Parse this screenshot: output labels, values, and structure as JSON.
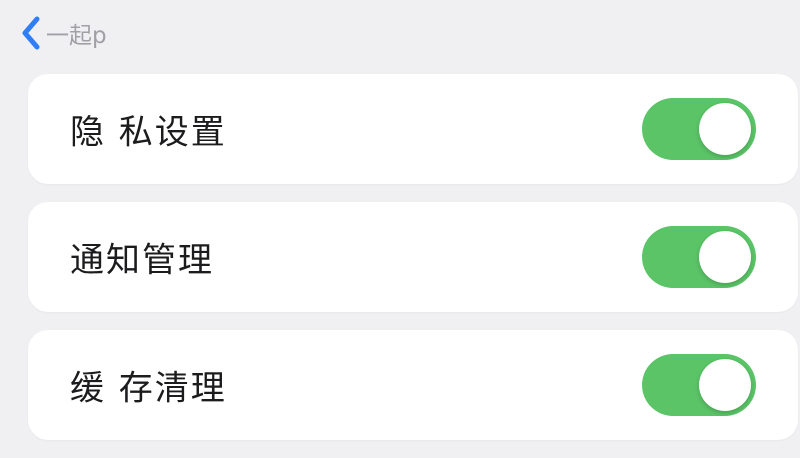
{
  "nav": {
    "back_icon": "chevron-left-icon",
    "back_label": "一起p"
  },
  "colors": {
    "accent": "#2f7ef6",
    "toggle_on": "#5ac467",
    "background": "#f0f0f3",
    "card": "#ffffff",
    "text": "#1c1c1e",
    "muted": "#a0a0a6"
  },
  "settings": [
    {
      "label": "隐 私设置",
      "toggle_on": true
    },
    {
      "label": "通知管理",
      "toggle_on": true
    },
    {
      "label": "缓 存清理",
      "toggle_on": true
    }
  ]
}
